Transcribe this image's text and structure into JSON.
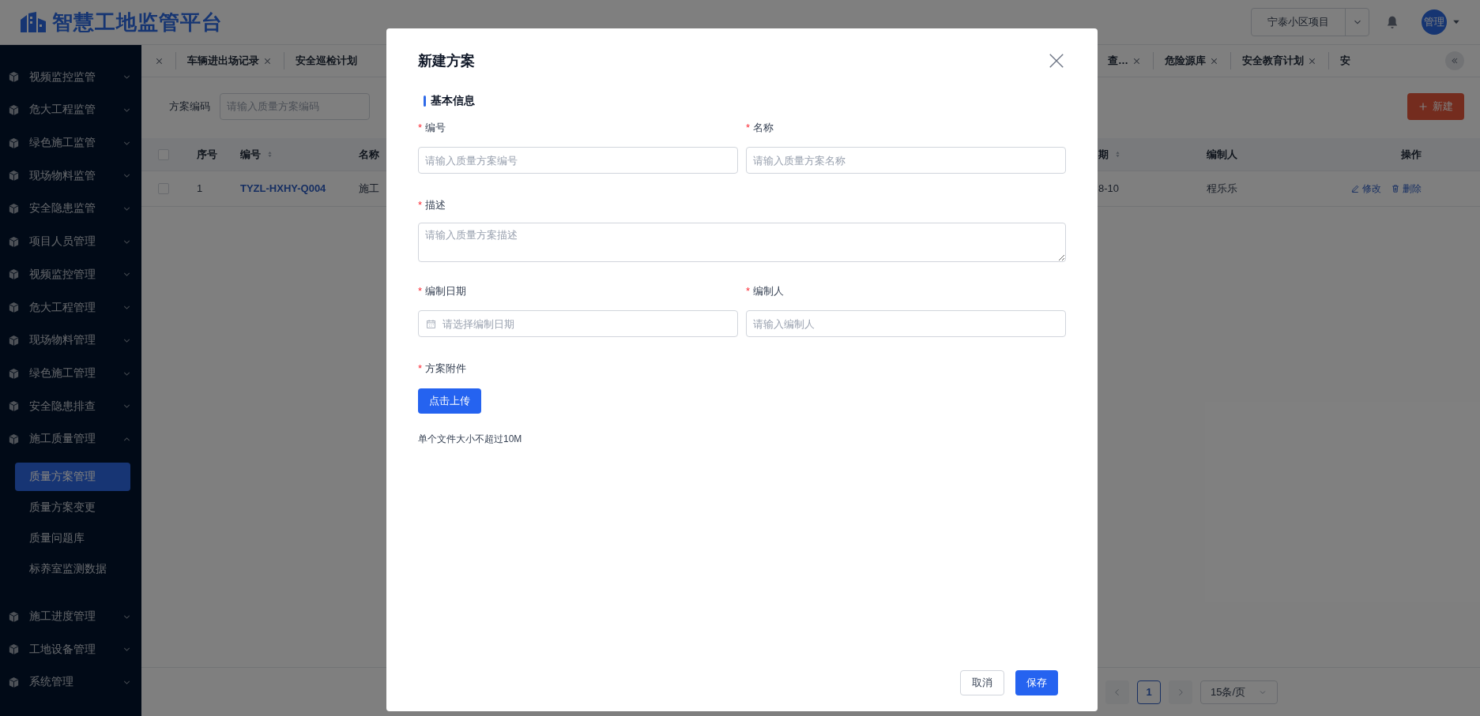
{
  "header": {
    "logo_text": "智慧工地监管平台",
    "project_select": "宁泰小区项目",
    "avatar_text": "管理"
  },
  "sidebar": {
    "items": [
      {
        "label": "视频监控监管",
        "expanded": false
      },
      {
        "label": "危大工程监管",
        "expanded": false
      },
      {
        "label": "绿色施工监管",
        "expanded": false
      },
      {
        "label": "现场物料监管",
        "expanded": false
      },
      {
        "label": "安全隐患监管",
        "expanded": false
      },
      {
        "label": "项目人员管理",
        "expanded": false
      },
      {
        "label": "视频监控管理",
        "expanded": false
      },
      {
        "label": "危大工程管理",
        "expanded": false
      },
      {
        "label": "现场物料管理",
        "expanded": false
      },
      {
        "label": "绿色施工管理",
        "expanded": false
      },
      {
        "label": "安全隐患排查",
        "expanded": false
      },
      {
        "label": "施工质量管理",
        "expanded": true,
        "children": [
          {
            "label": "质量方案管理",
            "selected": true
          },
          {
            "label": "质量方案变更",
            "selected": false
          },
          {
            "label": "质量问题库",
            "selected": false
          },
          {
            "label": "标养室监测数据",
            "selected": false
          }
        ]
      },
      {
        "label": "施工进度管理",
        "expanded": false
      },
      {
        "label": "工地设备管理",
        "expanded": false
      },
      {
        "label": "系统管理",
        "expanded": false
      }
    ]
  },
  "tabs_left": [
    {
      "closable": true
    },
    {
      "label": "车辆进出场记录",
      "closable": true
    },
    {
      "label": "安全巡检计划",
      "closable": false
    }
  ],
  "tabs_right": [
    {
      "label": "查…",
      "closable": true
    },
    {
      "label": "危险源库",
      "closable": true
    },
    {
      "label": "安全教育计划",
      "closable": true
    },
    {
      "label": "安",
      "closable": false
    }
  ],
  "filter": {
    "label": "方案编码",
    "placeholder": "请输入质量方案编码"
  },
  "new_button": "新建",
  "table": {
    "columns_left": [
      {
        "kind": "checkbox",
        "checked": false
      },
      {
        "label": "序号",
        "sortable": false
      },
      {
        "label": "编号",
        "sortable": true
      },
      {
        "label": "名称"
      }
    ],
    "columns_right": [
      {
        "label": "期",
        "sortable": true
      },
      {
        "label": "编制人",
        "sortable": false
      },
      {
        "label": "操作",
        "sortable": false
      }
    ],
    "rows": [
      {
        "checked": false,
        "index": "1",
        "code": "TYZL-HXHY-Q004",
        "name": "施工",
        "date": "8-10",
        "author": "程乐乐",
        "actions": [
          "修改",
          "删除"
        ]
      }
    ]
  },
  "pagination": {
    "page": "1",
    "page_size": "15条/页"
  },
  "modal": {
    "title": "新建方案",
    "section": "基本信息",
    "rows": [
      [
        {
          "label": "编号",
          "required_mark": "*",
          "kind": "input",
          "placeholder": "请输入质量方案编号"
        },
        {
          "label": "名称",
          "required_mark": "*",
          "kind": "input",
          "placeholder": "请输入质量方案名称"
        }
      ],
      [
        {
          "label": "描述",
          "required_mark": "*",
          "kind": "textarea",
          "placeholder": "请输入质量方案描述"
        }
      ],
      [
        {
          "label": "编制日期",
          "required_mark": "*",
          "kind": "date",
          "placeholder": "请选择编制日期"
        },
        {
          "label": "编制人",
          "required_mark": "*",
          "kind": "input",
          "placeholder": "请输入编制人"
        }
      ]
    ],
    "upload": {
      "label": "方案附件",
      "required_mark": "*",
      "button": "点击上传",
      "hint": "单个文件大小不超过10M"
    },
    "cancel": "取消",
    "save": "保存"
  }
}
